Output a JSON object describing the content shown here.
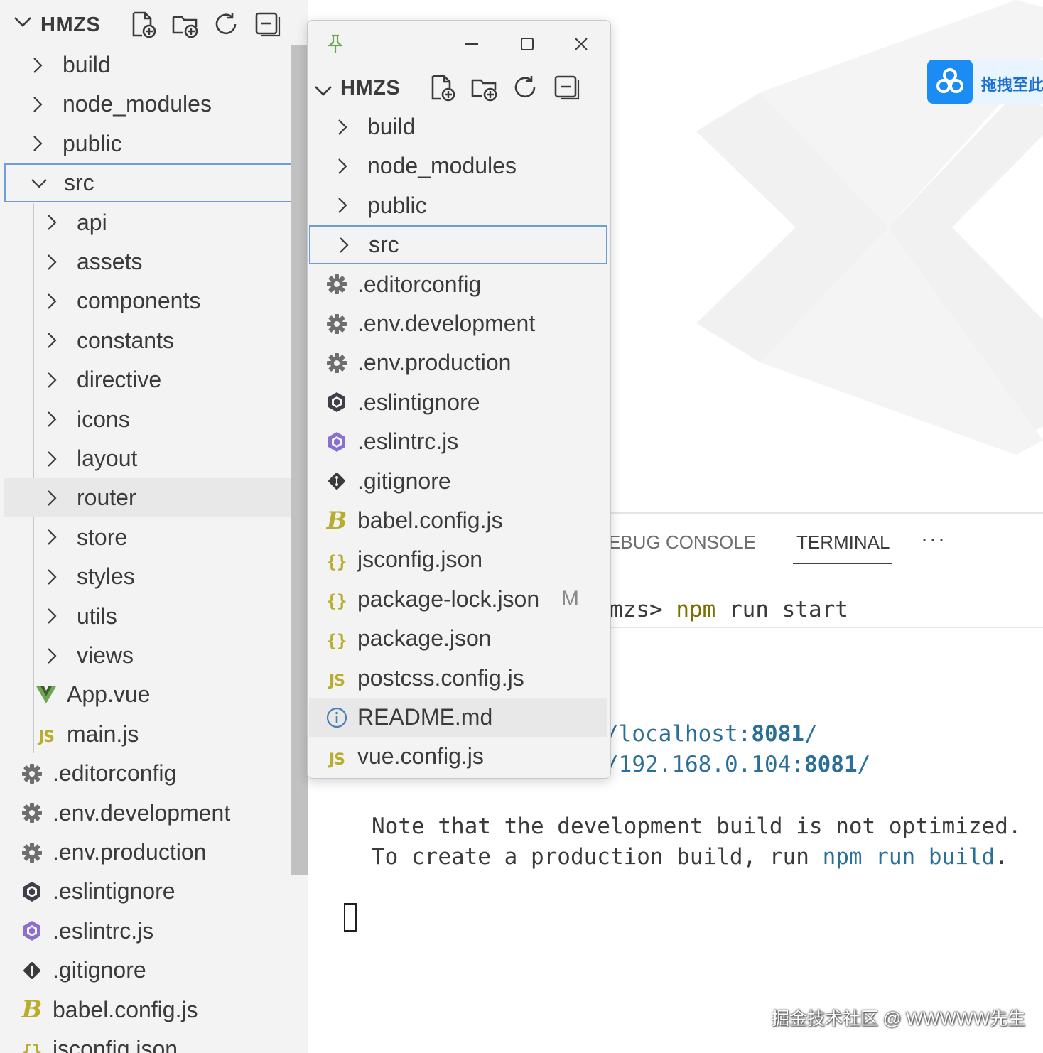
{
  "explorer": {
    "title": "HMZS",
    "actions": [
      "new-file-icon",
      "new-folder-icon",
      "refresh-icon",
      "collapse-all-icon"
    ],
    "items": [
      {
        "label": "build",
        "kind": "folder"
      },
      {
        "label": "node_modules",
        "kind": "folder"
      },
      {
        "label": "public",
        "kind": "folder"
      },
      {
        "label": "src",
        "kind": "folder-open"
      },
      {
        "label": "api",
        "kind": "folder"
      },
      {
        "label": "assets",
        "kind": "folder"
      },
      {
        "label": "components",
        "kind": "folder"
      },
      {
        "label": "constants",
        "kind": "folder"
      },
      {
        "label": "directive",
        "kind": "folder"
      },
      {
        "label": "icons",
        "kind": "folder"
      },
      {
        "label": "layout",
        "kind": "folder"
      },
      {
        "label": "router",
        "kind": "folder"
      },
      {
        "label": "store",
        "kind": "folder"
      },
      {
        "label": "styles",
        "kind": "folder"
      },
      {
        "label": "utils",
        "kind": "folder"
      },
      {
        "label": "views",
        "kind": "folder"
      },
      {
        "label": "App.vue",
        "kind": "vue"
      },
      {
        "label": "main.js",
        "kind": "js"
      },
      {
        "label": ".editorconfig",
        "kind": "gear"
      },
      {
        "label": ".env.development",
        "kind": "gear"
      },
      {
        "label": ".env.production",
        "kind": "gear"
      },
      {
        "label": ".eslintignore",
        "kind": "eslint-dark"
      },
      {
        "label": ".eslintrc.js",
        "kind": "eslint"
      },
      {
        "label": ".gitignore",
        "kind": "git"
      },
      {
        "label": "babel.config.js",
        "kind": "babel"
      },
      {
        "label": "jsconfig.json",
        "kind": "json"
      }
    ]
  },
  "floating_window": {
    "title": "HMZS",
    "items": [
      {
        "label": "build",
        "kind": "folder"
      },
      {
        "label": "node_modules",
        "kind": "folder"
      },
      {
        "label": "public",
        "kind": "folder"
      },
      {
        "label": "src",
        "kind": "folder"
      },
      {
        "label": ".editorconfig",
        "kind": "gear"
      },
      {
        "label": ".env.development",
        "kind": "gear"
      },
      {
        "label": ".env.production",
        "kind": "gear"
      },
      {
        "label": ".eslintignore",
        "kind": "eslint-dark"
      },
      {
        "label": ".eslintrc.js",
        "kind": "eslint"
      },
      {
        "label": ".gitignore",
        "kind": "git"
      },
      {
        "label": "babel.config.js",
        "kind": "babel"
      },
      {
        "label": "jsconfig.json",
        "kind": "json"
      },
      {
        "label": "package-lock.json",
        "kind": "json",
        "badge": "M"
      },
      {
        "label": "package.json",
        "kind": "json"
      },
      {
        "label": "postcss.config.js",
        "kind": "js"
      },
      {
        "label": "README.md",
        "kind": "info"
      },
      {
        "label": "vue.config.js",
        "kind": "js"
      }
    ]
  },
  "baidu": {
    "label": "拖拽至此"
  },
  "panel": {
    "tabs": [
      "EBUG CONSOLE",
      "TERMINAL"
    ],
    "active_tab": "TERMINAL",
    "more": "···"
  },
  "terminal": {
    "prompt": "mzs> ",
    "cmd_npm": "npm",
    "cmd_rest": " run start",
    "local_prefix": "/localhost:",
    "local_port": "8081",
    "local_suffix": "/",
    "net_prefix": "/192.168.0.104:",
    "net_port": "8081",
    "net_suffix": "/",
    "note1": "Note that the development build is not optimized.",
    "note2_prefix": "To create a production build, run ",
    "note2_cmd": "npm run build",
    "note2_suffix": "."
  },
  "credit": "掘金技术社区 @ WWWWW先生",
  "colors": {
    "selection_border": "#6d9ed8",
    "sidebar_bg": "#f3f3f3",
    "js_yellow": "#b8ad2e",
    "eslint_purple": "#8b6fd0",
    "terminal_blue": "#2a6f97",
    "terminal_yellow": "#7b6f00",
    "baidu_blue": "#1a8cf4"
  }
}
